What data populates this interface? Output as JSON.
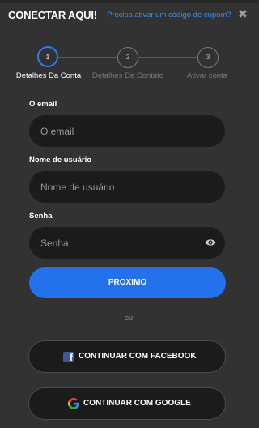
{
  "header": {
    "title": "CONECTAR AQUI!",
    "coupon_link": "Precisa ativar um código de cupom?",
    "close_glyph": "✖"
  },
  "stepper": {
    "active_step": 1,
    "steps": [
      {
        "number": "1",
        "label": "Detalhes Da Conta"
      },
      {
        "number": "2",
        "label": "Detalhes De Contato"
      },
      {
        "number": "3",
        "label": "Ativar conta"
      }
    ]
  },
  "form": {
    "email": {
      "label": "O email",
      "placeholder": "O email",
      "value": ""
    },
    "username": {
      "label": "Nome de usuário",
      "placeholder": "Nome de usuário",
      "value": ""
    },
    "password": {
      "label": "Senha",
      "placeholder": "Senha",
      "value": "",
      "toggle_icon": "eye-icon"
    },
    "submit_label": "PROXIMO"
  },
  "divider_text": "ou",
  "social": {
    "facebook": {
      "label": "CONTINUAR COM FACEBOOK",
      "icon": "facebook-icon"
    },
    "google": {
      "label": "CONTINUAR COM GOOGLE",
      "icon": "google-icon"
    }
  },
  "colors": {
    "background": "#323232",
    "accent": "#2472eb",
    "link": "#3b8eea",
    "field": "#1b1b1b"
  }
}
